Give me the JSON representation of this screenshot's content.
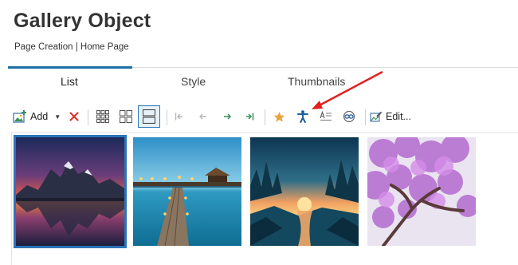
{
  "page": {
    "title": "Gallery Object",
    "breadcrumb": "Page Creation | Home Page"
  },
  "tabs": [
    {
      "label": "List",
      "active": true
    },
    {
      "label": "Style",
      "active": false
    },
    {
      "label": "Thumbnails",
      "active": false
    }
  ],
  "toolbar": {
    "add_label": "Add",
    "edit_label": "Edit...",
    "icons": [
      "add-image-icon",
      "dropdown-caret-icon",
      "delete-icon",
      "grid-small-icon",
      "grid-large-icon",
      "list-view-icon",
      "first-icon",
      "previous-icon",
      "next-icon",
      "last-icon",
      "star-icon",
      "accessibility-icon",
      "caption-icon",
      "link-icon",
      "edit-icon"
    ]
  },
  "gallery": {
    "items": [
      {
        "name": "mountain-lake-sunset",
        "selected": true
      },
      {
        "name": "tropical-pier",
        "selected": false
      },
      {
        "name": "forest-river-sunset",
        "selected": false
      },
      {
        "name": "purple-blossom-tree",
        "selected": false
      }
    ]
  },
  "colors": {
    "accent": "#1e6fa8",
    "selection": "#2a74b8",
    "delete": "#d9362b",
    "star": "#e8a33d",
    "accessibility": "#1f5f9c",
    "arrow": "#e02020",
    "nav_active": "#3a8f5a"
  }
}
